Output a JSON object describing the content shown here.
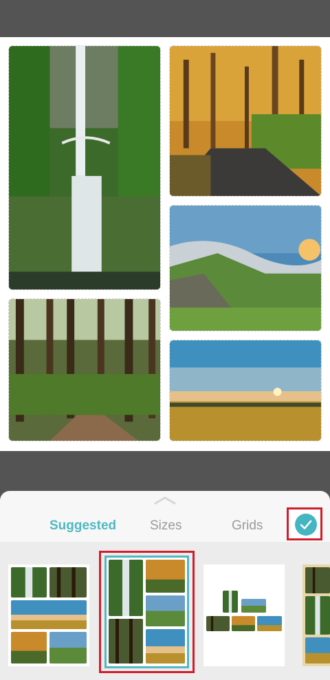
{
  "tabs": [
    {
      "label": "Suggested",
      "active": true
    },
    {
      "label": "Sizes",
      "active": false
    },
    {
      "label": "Grids",
      "active": false
    }
  ],
  "photos": [
    "waterfall",
    "autumn-forest",
    "misty-hills",
    "forest-path",
    "sunset-field"
  ],
  "colors": {
    "accent": "#4fb8c2",
    "highlight": "#d11d2a"
  },
  "icons": {
    "confirm": "check-icon",
    "handle": "chevron-up-icon"
  }
}
